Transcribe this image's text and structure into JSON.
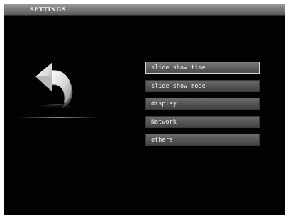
{
  "header": {
    "title": "SETTINGS"
  },
  "back_button": {
    "icon": "curved-back-arrow-icon"
  },
  "menu": {
    "selected_index": 0,
    "items": [
      {
        "label": "slide show time"
      },
      {
        "label": "slide show mode"
      },
      {
        "label": "display"
      },
      {
        "label": "Network"
      },
      {
        "label": "others"
      }
    ]
  },
  "colors": {
    "background": "#020202",
    "title_bar": "#7a7a7a",
    "menu_item": "#555555",
    "selected_border": "#d8d8d8",
    "text": "#f0f0f0"
  }
}
